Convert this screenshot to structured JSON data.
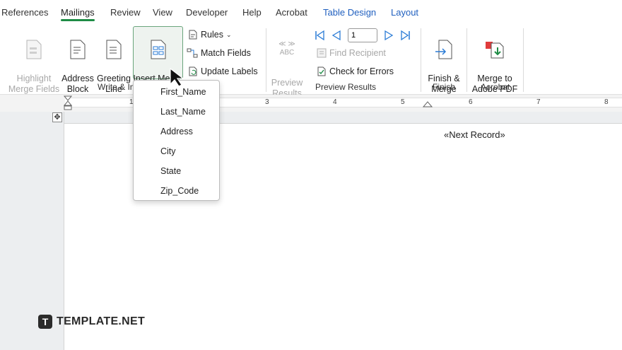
{
  "tabs": [
    "References",
    "Mailings",
    "Review",
    "View",
    "Developer",
    "Help",
    "Acrobat",
    "Table Design",
    "Layout"
  ],
  "ribbon": {
    "highlight": "Highlight\nMerge Fields",
    "address": "Address\nBlock",
    "greeting": "Greeting\nLine",
    "insert_merge": "Insert Merge\nField",
    "rules": "Rules",
    "match_fields": "Match Fields",
    "update_labels": "Update Labels",
    "preview_results": "Preview\nResults",
    "abc": "ABC",
    "record_num": "1",
    "find_recipient": "Find Recipient",
    "check_errors": "Check for Errors",
    "finish_merge": "Finish &\nMerge",
    "merge_pdf": "Merge to\nAdobe PDF",
    "groups": {
      "write_insert": "Write & In",
      "preview": "Preview Results",
      "finish": "Finish",
      "acrobat": "Acrobat"
    }
  },
  "ruler": [
    "1",
    "3",
    "4",
    "5",
    "6",
    "7",
    "8"
  ],
  "document": {
    "next_record": "«Next Record»"
  },
  "dropdown": [
    "First_Name",
    "Last_Name",
    "Address",
    "City",
    "State",
    "Zip_Code"
  ],
  "watermark": "TEMPLATE.NET",
  "colors": {
    "accent": "#1e8c45",
    "contextual_tab": "#1f5fbf",
    "nav_blue": "#2a7bd6"
  }
}
